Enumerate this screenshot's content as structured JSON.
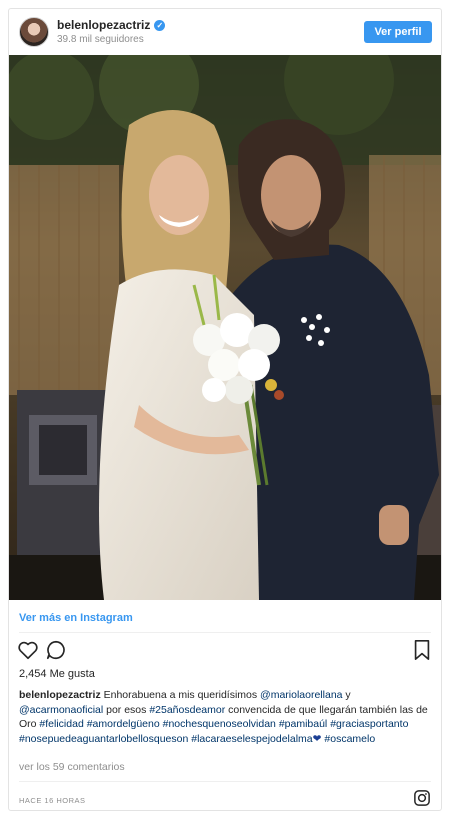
{
  "header": {
    "username": "belenlopezactriz",
    "verified_icon": "check-badge-icon",
    "followers": "39.8 mil seguidores",
    "view_profile_label": "Ver perfil"
  },
  "post": {
    "more_link": "Ver más en Instagram",
    "likes": "2,454 Me gusta",
    "caption": {
      "username": "belenlopezactriz",
      "text_1": " Enhorabuena a mis queridísimos ",
      "mention_1": "@mariolaorellana",
      "text_2": " y ",
      "mention_2": "@acarmonaoficial",
      "text_3": " por esos ",
      "tag_1": "#25añosdeamor",
      "text_4": " convencida de que llegarán también las de Oro ",
      "tags_rest": [
        "#felicidad",
        "#amordelgüeno",
        "#nochesquenoseolvidan",
        "#pamibaúl",
        "#graciasportanto",
        "#nosepuedeaguantarlobellosqueson",
        "#lacaraeselespejodelalma"
      ],
      "heart": "❤",
      "tag_last": "#oscamelo"
    },
    "comments_link": "ver los 59 comentarios",
    "time": "HACE 16 HORAS"
  },
  "icons": {
    "like": "heart-icon",
    "comment": "comment-icon",
    "save": "bookmark-icon",
    "instagram": "instagram-icon"
  },
  "colors": {
    "accent": "#3897f0",
    "hashtag": "#003569",
    "muted": "#8e8e8e"
  }
}
